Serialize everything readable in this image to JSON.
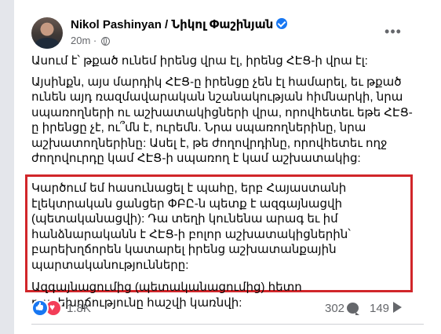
{
  "post": {
    "author": "Nikol Pashinyan / Նիկոլ Փաշինյան",
    "time": "20m",
    "time_separator": "·",
    "more_icon": "more-horizontal-icon",
    "verified_icon": "verified-badge-icon",
    "audience_icon": "globe-icon",
    "paragraphs": [
      "Ասում է՝ թքած ունեմ իրենց վրա էլ, իրենց ՀԷՑ-ի վրա էլ:",
      "Այսինքն, այս մարդիկ ՀԷՑ-ը իրենցը չեն էլ համարել, եւ թքած ունեն այդ ռազմավարական նշանակության հիմնարկի, նրա սպառողների ու աշխատակիցների վրա, որովհետեւ եթե ՀԷՑ-ը իրենցը չէ, ու՞մն է, ուրեմն. Նրա սպառողներինը, նրա աշխատողներինը: Ասել է, թե ժողովրդինը, որովհետեւ ողջ ժողովուրդը կամ ՀԷՑ-ի սպառող է կամ աշխատակից:"
    ],
    "highlighted_paragraphs": [
      "Կարծում եմ հասունացել է պահը, երբ Հայաստանի էլեկտրական ցանցեր ՓԲԸ-ն պետք է ազգայնացվի (պետականացվի): Դա տեղի կունենա արագ եւ իմ հանձնարականն է ՀԷՑ-ի բոլոր աշխատակիցներին՝ բարեխղճորեն կատարել իրենց աշխատանքային պարտականությունները:",
      "Ազգայնացումից (պետականացումից) հետո բարեխղճությունը հաշվի կառնվի:"
    ],
    "highlight_color": "#d1262a"
  },
  "footer": {
    "reaction_icons": [
      "like-icon",
      "love-icon"
    ],
    "reactions_count": "1.8K",
    "comments_count": "302",
    "shares_count": "149"
  },
  "colors": {
    "link_blue": "#1877f2",
    "text": "#050505",
    "muted": "#65676b"
  }
}
